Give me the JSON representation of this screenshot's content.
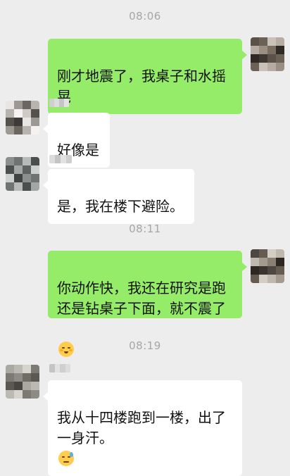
{
  "chat": {
    "messages": [
      {
        "type": "timestamp",
        "text": "08:06"
      },
      {
        "type": "sent",
        "text": "刚才地震了，我桌子和水摇\n晃"
      },
      {
        "type": "received",
        "text": "好像是"
      },
      {
        "type": "received",
        "text": "是，我在楼下避险。"
      },
      {
        "type": "timestamp",
        "text": "08:11"
      },
      {
        "type": "sent",
        "text": "你动作快，我还在研究是跑\n还是钻桌子下面，就不震了",
        "emoji": "flushed-face-icon"
      },
      {
        "type": "timestamp",
        "text": "08:19"
      },
      {
        "type": "received",
        "text": "我从十四楼跑到一楼，出了\n一身汗。",
        "emoji": "sweat-smile-face-icon"
      }
    ]
  },
  "colors": {
    "background": "#ededed",
    "sent_bubble": "#95ec69",
    "received_bubble": "#ffffff",
    "timestamp_text": "#a6a6a6",
    "message_text": "#111111"
  }
}
